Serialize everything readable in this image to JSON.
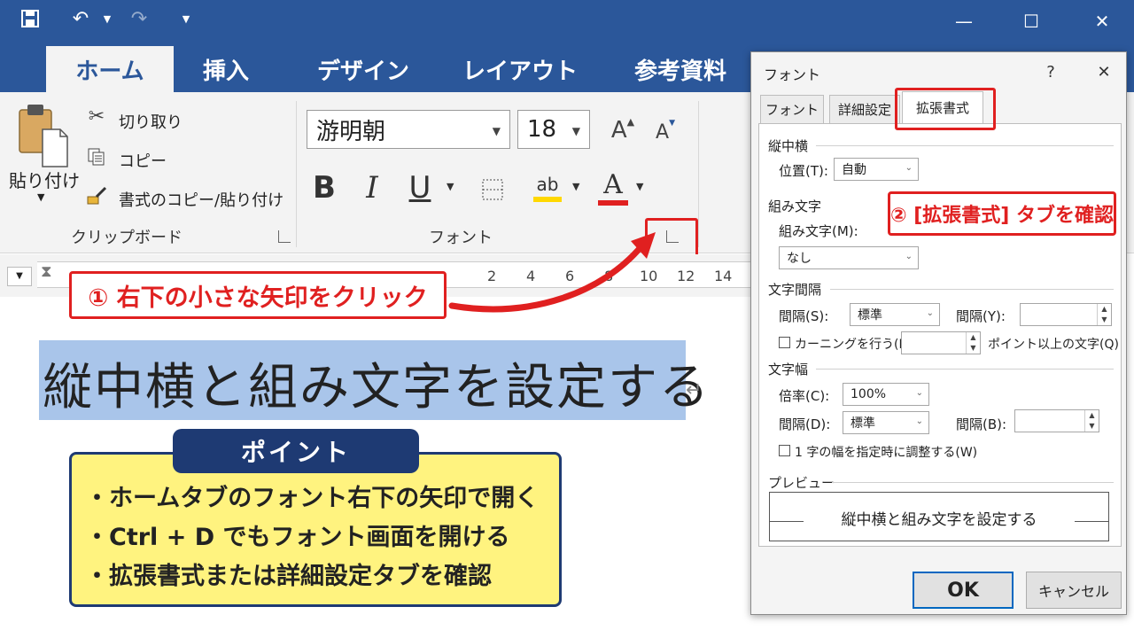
{
  "qat": {
    "undo_icon": "undo-icon",
    "redo_icon": "redo-icon",
    "save_icon": "save-icon"
  },
  "tabs": [
    {
      "label": "ホーム"
    },
    {
      "label": "挿入"
    },
    {
      "label": "デザイン"
    },
    {
      "label": "レイアウト"
    },
    {
      "label": "参考資料"
    }
  ],
  "clipboard": {
    "paste": "貼り付け",
    "cut": "切り取り",
    "copy": "コピー",
    "format_painter": "書式のコピー/貼り付け",
    "group_label": "クリップボード"
  },
  "font_group": {
    "font_name": "游明朝",
    "font_size": "18",
    "grow": "A",
    "shrink": "A",
    "bold": "B",
    "italic": "I",
    "underline": "U",
    "highlight": "ab",
    "font_color": "A",
    "group_label": "フォント"
  },
  "ruler": {
    "numbers": [
      "2",
      "4",
      "6",
      "8",
      "10",
      "12",
      "14"
    ]
  },
  "document": {
    "text": "縦中横と組み文字を設定する",
    "pilcrow": "↵"
  },
  "callout1": "① 右下の小さな矢印をクリック",
  "callout2": "② [拡張書式] タブを確認",
  "point": {
    "title": "ポイント",
    "items": [
      "・ホームタブのフォント右下の矢印で開く",
      "・Ctrl + D でもフォント画面を開ける",
      "・拡張書式または詳細設定タブを確認"
    ]
  },
  "dialog": {
    "title": "フォント",
    "help": "?",
    "close": "✕",
    "tabs": [
      "フォント",
      "詳細設定",
      "拡張書式"
    ],
    "tatechuyoko": {
      "heading": "縦中横",
      "position_label": "位置(T):",
      "position_value": "自動"
    },
    "kumimoji": {
      "heading": "組み文字",
      "label": "組み文字(M):",
      "value": "なし"
    },
    "spacing": {
      "heading": "文字間隔",
      "interval_label": "間隔(S):",
      "interval_value": "標準",
      "interval_y_label": "間隔(Y):",
      "kerning_label": "カーニングを行う(K):",
      "kerning_suffix": "ポイント以上の文字(Q)"
    },
    "width": {
      "heading": "文字幅",
      "scale_label": "倍率(C):",
      "scale_value": "100%",
      "interval_label": "間隔(D):",
      "interval_value": "標準",
      "interval_b_label": "間隔(B):",
      "grid_label": "1 字の幅を指定時に調整する(W)"
    },
    "preview": {
      "heading": "プレビュー",
      "text": "縦中横と組み文字を設定する"
    },
    "ok": "OK",
    "cancel": "キャンセル"
  },
  "colors": {
    "title_bar": "#2b579a",
    "accent_red": "#e02020",
    "point_bg": "#fff37f",
    "point_navy": "#1e3a73",
    "highlight": "#a9c5ea"
  }
}
